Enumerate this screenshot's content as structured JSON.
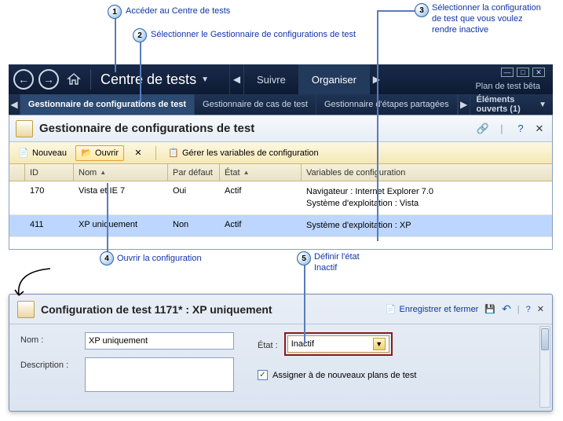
{
  "callouts": {
    "c1": "Accéder au Centre de tests",
    "c2": "Sélectionner le Gestionnaire de configurations de test",
    "c3": "Sélectionner la configuration de test que vous voulez rendre inactive",
    "c4": "Ouvrir la configuration",
    "c5a": "Définir l'état",
    "c5b": "Inactif"
  },
  "appbar": {
    "title": "Centre de tests",
    "tab_suivre": "Suivre",
    "tab_organiser": "Organiser",
    "plan": "Plan de test bêta"
  },
  "subtabs": {
    "t1": "Gestionnaire de configurations de test",
    "t2": "Gestionnaire de cas de test",
    "t3": "Gestionnaire d'étapes partagées",
    "open": "Éléments ouverts (1)"
  },
  "mgr": {
    "title": "Gestionnaire de configurations de test",
    "btn_new": "Nouveau",
    "btn_open": "Ouvrir",
    "btn_vars": "Gérer les variables de configuration",
    "cols": {
      "id": "ID",
      "nom": "Nom",
      "def": "Par défaut",
      "etat": "État",
      "vars": "Variables de configuration"
    },
    "rows": [
      {
        "id": "170",
        "nom": "Vista et IE 7",
        "def": "Oui",
        "etat": "Actif",
        "vars": "Navigateur : Internet Explorer 7.0\nSystème d'exploitation : Vista"
      },
      {
        "id": "411",
        "nom": "XP uniquement",
        "def": "Non",
        "etat": "Actif",
        "vars": "Système d'exploitation : XP"
      }
    ]
  },
  "detail": {
    "title": "Configuration de test 1171* : XP uniquement",
    "save_close": "Enregistrer et fermer",
    "lbl_nom": "Nom :",
    "val_nom": "XP uniquement",
    "lbl_desc": "Description :",
    "lbl_etat": "État :",
    "val_etat": "Inactif",
    "chk_assign": "Assigner à de nouveaux plans de test"
  }
}
